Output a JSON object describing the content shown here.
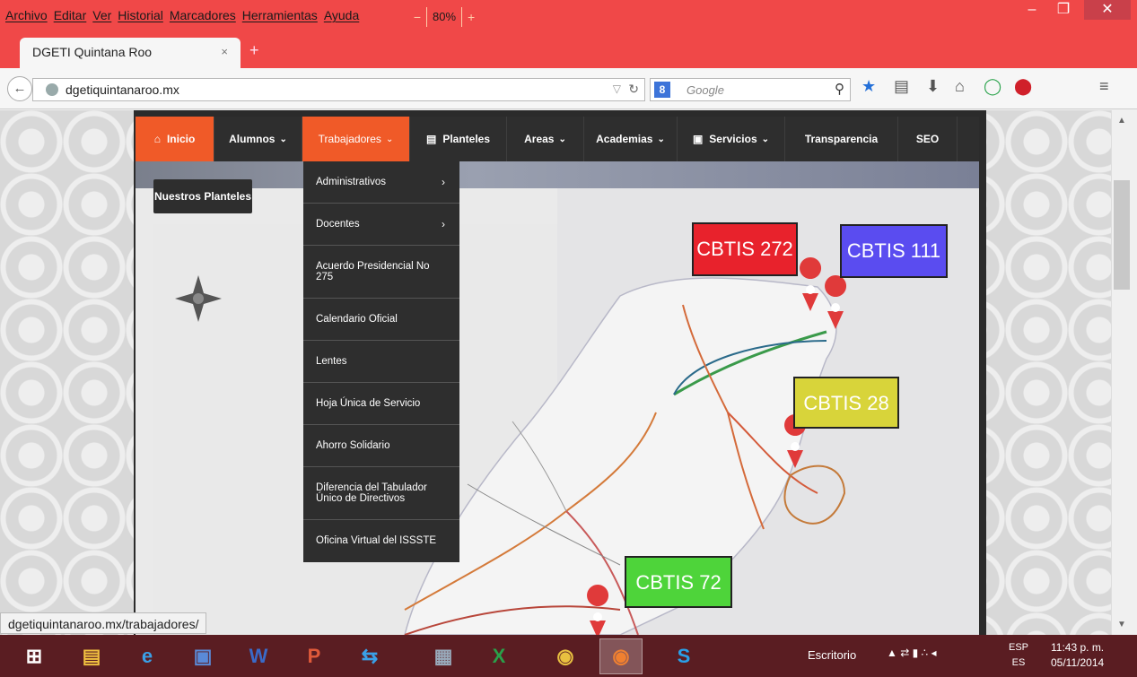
{
  "browser": {
    "menus": [
      "Archivo",
      "Editar",
      "Ver",
      "Historial",
      "Marcadores",
      "Herramientas",
      "Ayuda"
    ],
    "zoom_minus": "−",
    "zoom": "80%",
    "zoom_plus": "+",
    "tab_title": "DGETI Quintana Roo",
    "tab_close": "×",
    "new_tab": "+",
    "url": "dgetiquintanaroo.mx",
    "search_engine": "8",
    "search_placeholder": "Google",
    "status_url": "dgetiquintanaroo.mx/trabajadores/",
    "accent": "#f04848"
  },
  "site": {
    "nav": [
      {
        "label": "Inicio",
        "icon": "home-icon",
        "state": "active"
      },
      {
        "label": "Alumnos",
        "has_dropdown": true
      },
      {
        "label": "Trabajadores",
        "has_dropdown": true,
        "state": "open"
      },
      {
        "label": "Planteles",
        "icon": "building-icon"
      },
      {
        "label": "Areas",
        "has_dropdown": true
      },
      {
        "label": "Academias",
        "has_dropdown": true
      },
      {
        "label": "Servicios",
        "icon": "briefcase-icon",
        "has_dropdown": true
      },
      {
        "label": "Transparencia"
      },
      {
        "label": "SEO"
      }
    ],
    "dropdown": [
      {
        "label": "Administrativos",
        "submenu": true
      },
      {
        "label": "Docentes",
        "submenu": true
      },
      {
        "label": "Acuerdo Presidencial No 275"
      },
      {
        "label": "Calendario Oficial"
      },
      {
        "label": "Lentes"
      },
      {
        "label": "Hoja Única de Servicio"
      },
      {
        "label": "Ahorro Solidario"
      },
      {
        "label": "Diferencia del Tabulador Único de Directivos"
      },
      {
        "label": "Oficina Virtual del ISSSTE"
      }
    ],
    "planteles_button": "Nuestros Planteles",
    "map_labels": {
      "cbtis_272": "CBTIS 272",
      "cbtis_111": "CBTIS 111",
      "cbtis_28": "CBTIS 28",
      "cbtis_72": "CBTIS 72"
    },
    "accent": "#f05a28"
  },
  "taskbar": {
    "escritorio": "Escritorio",
    "lang_top": "ESP",
    "lang_bottom": "ES",
    "time": "11:43 p. m.",
    "date": "05/11/2014",
    "apps": [
      "windows-start-icon",
      "file-explorer-icon",
      "internet-explorer-icon",
      "app-icon",
      "word-icon",
      "powerpoint-icon",
      "teamviewer-icon",
      "calculator-icon",
      "excel-icon",
      "chrome-icon",
      "firefox-icon",
      "skype-icon"
    ]
  }
}
